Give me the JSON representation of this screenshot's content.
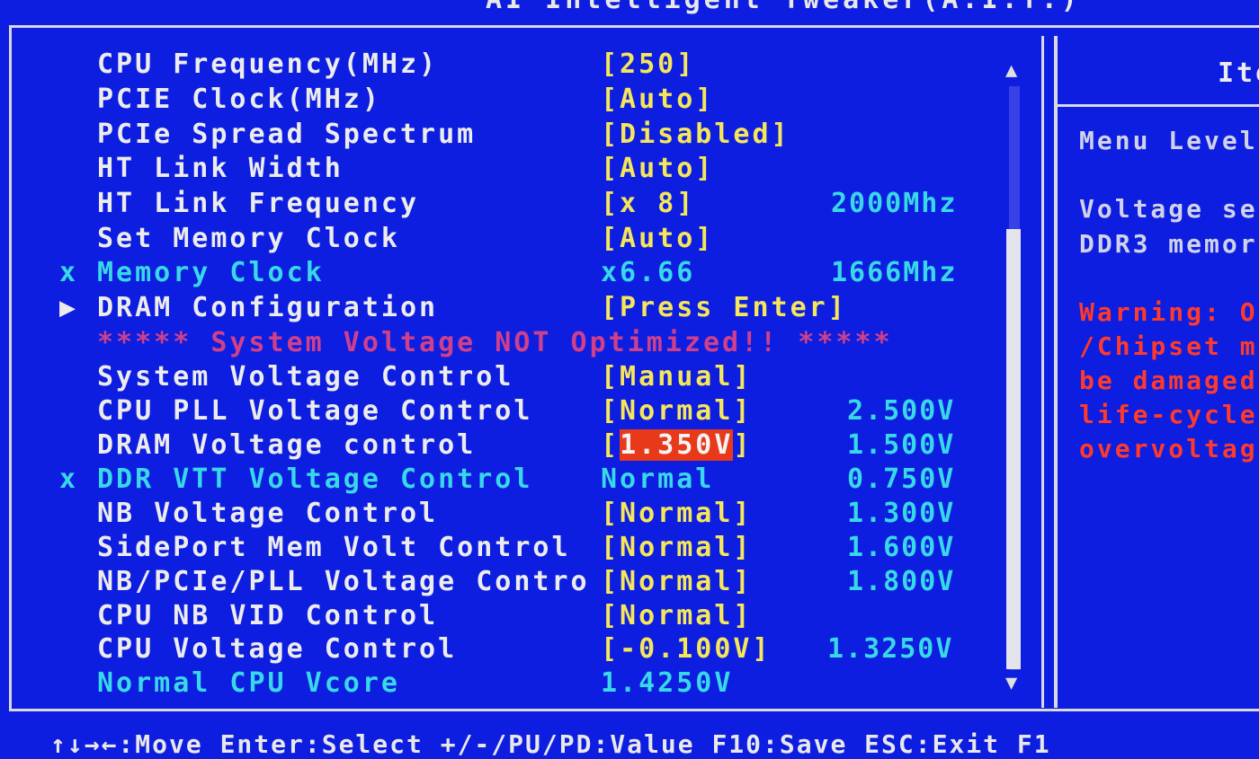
{
  "header": {
    "title": "AI Intelligent Tweaker(A.I.T.)"
  },
  "settings": [
    {
      "label": "CPU Frequency(MHz)",
      "value": "[250]",
      "extra": "",
      "marker": ""
    },
    {
      "label": "PCIE Clock(MHz)",
      "value": "[Auto]",
      "extra": "",
      "marker": ""
    },
    {
      "label": "PCIe Spread Spectrum",
      "value": "[Disabled]",
      "extra": "",
      "marker": ""
    },
    {
      "label": "HT Link Width",
      "value": "[Auto]",
      "extra": "",
      "marker": ""
    },
    {
      "label": "HT Link Frequency",
      "value": "[x 8]",
      "extra": "2000Mhz",
      "marker": ""
    },
    {
      "label": "Set Memory Clock",
      "value": "[Auto]",
      "extra": "",
      "marker": ""
    },
    {
      "label": "Memory Clock",
      "value": " x6.66",
      "extra": "1666Mhz",
      "marker": "x"
    },
    {
      "label": "DRAM Configuration",
      "value": "[Press Enter]",
      "extra": "",
      "marker": "▶"
    },
    {
      "label": "***** System Voltage NOT Optimized!! *****",
      "value": "",
      "extra": "",
      "marker": ""
    },
    {
      "label": "System Voltage Control",
      "value": "[Manual]",
      "extra": "",
      "marker": ""
    },
    {
      "label": "CPU PLL Voltage Control",
      "value": "[Normal]",
      "extra": "2.500V",
      "marker": ""
    },
    {
      "label": "DRAM Voltage control",
      "value": "1.350V",
      "extra": "1.500V",
      "marker": ""
    },
    {
      "label": "DDR VTT Voltage Control",
      "value": " Normal",
      "extra": "0.750V",
      "marker": "x"
    },
    {
      "label": "NB Voltage Control",
      "value": "[Normal]",
      "extra": "1.300V",
      "marker": ""
    },
    {
      "label": "SidePort Mem Volt Control",
      "value": "[Normal]",
      "extra": "1.600V",
      "marker": ""
    },
    {
      "label": "NB/PCIe/PLL Voltage Contro",
      "value": "[Normal]",
      "extra": "1.800V",
      "marker": ""
    },
    {
      "label": "CPU NB VID Control",
      "value": "[Normal]",
      "extra": "",
      "marker": ""
    },
    {
      "label": "CPU Voltage Control",
      "value": "[-0.100V]",
      "extra": "1.3250V",
      "marker": ""
    },
    {
      "label": "Normal CPU Vcore",
      "value": "1.4250V",
      "extra": "",
      "marker": ""
    }
  ],
  "help": {
    "title": "Ite",
    "menu_level": "Menu Level",
    "desc_1": "Voltage se",
    "desc_2": "DDR3 memor",
    "warn_1": "Warning: O",
    "warn_2": "/Chipset m",
    "warn_3": "be damaged",
    "warn_4": "life-cycle",
    "warn_5": "overvoltag"
  },
  "footer": {
    "text": "↑↓→←:Move  Enter:Select  +/-/PU/PD:Value  F10:Save  ESC:Exit  F1"
  },
  "colors": {
    "background": "#0d1ee0",
    "value": "#f5e65a",
    "info": "#39d8e8",
    "warning": "#ff3a2a",
    "highlight": "#e83a1a"
  }
}
